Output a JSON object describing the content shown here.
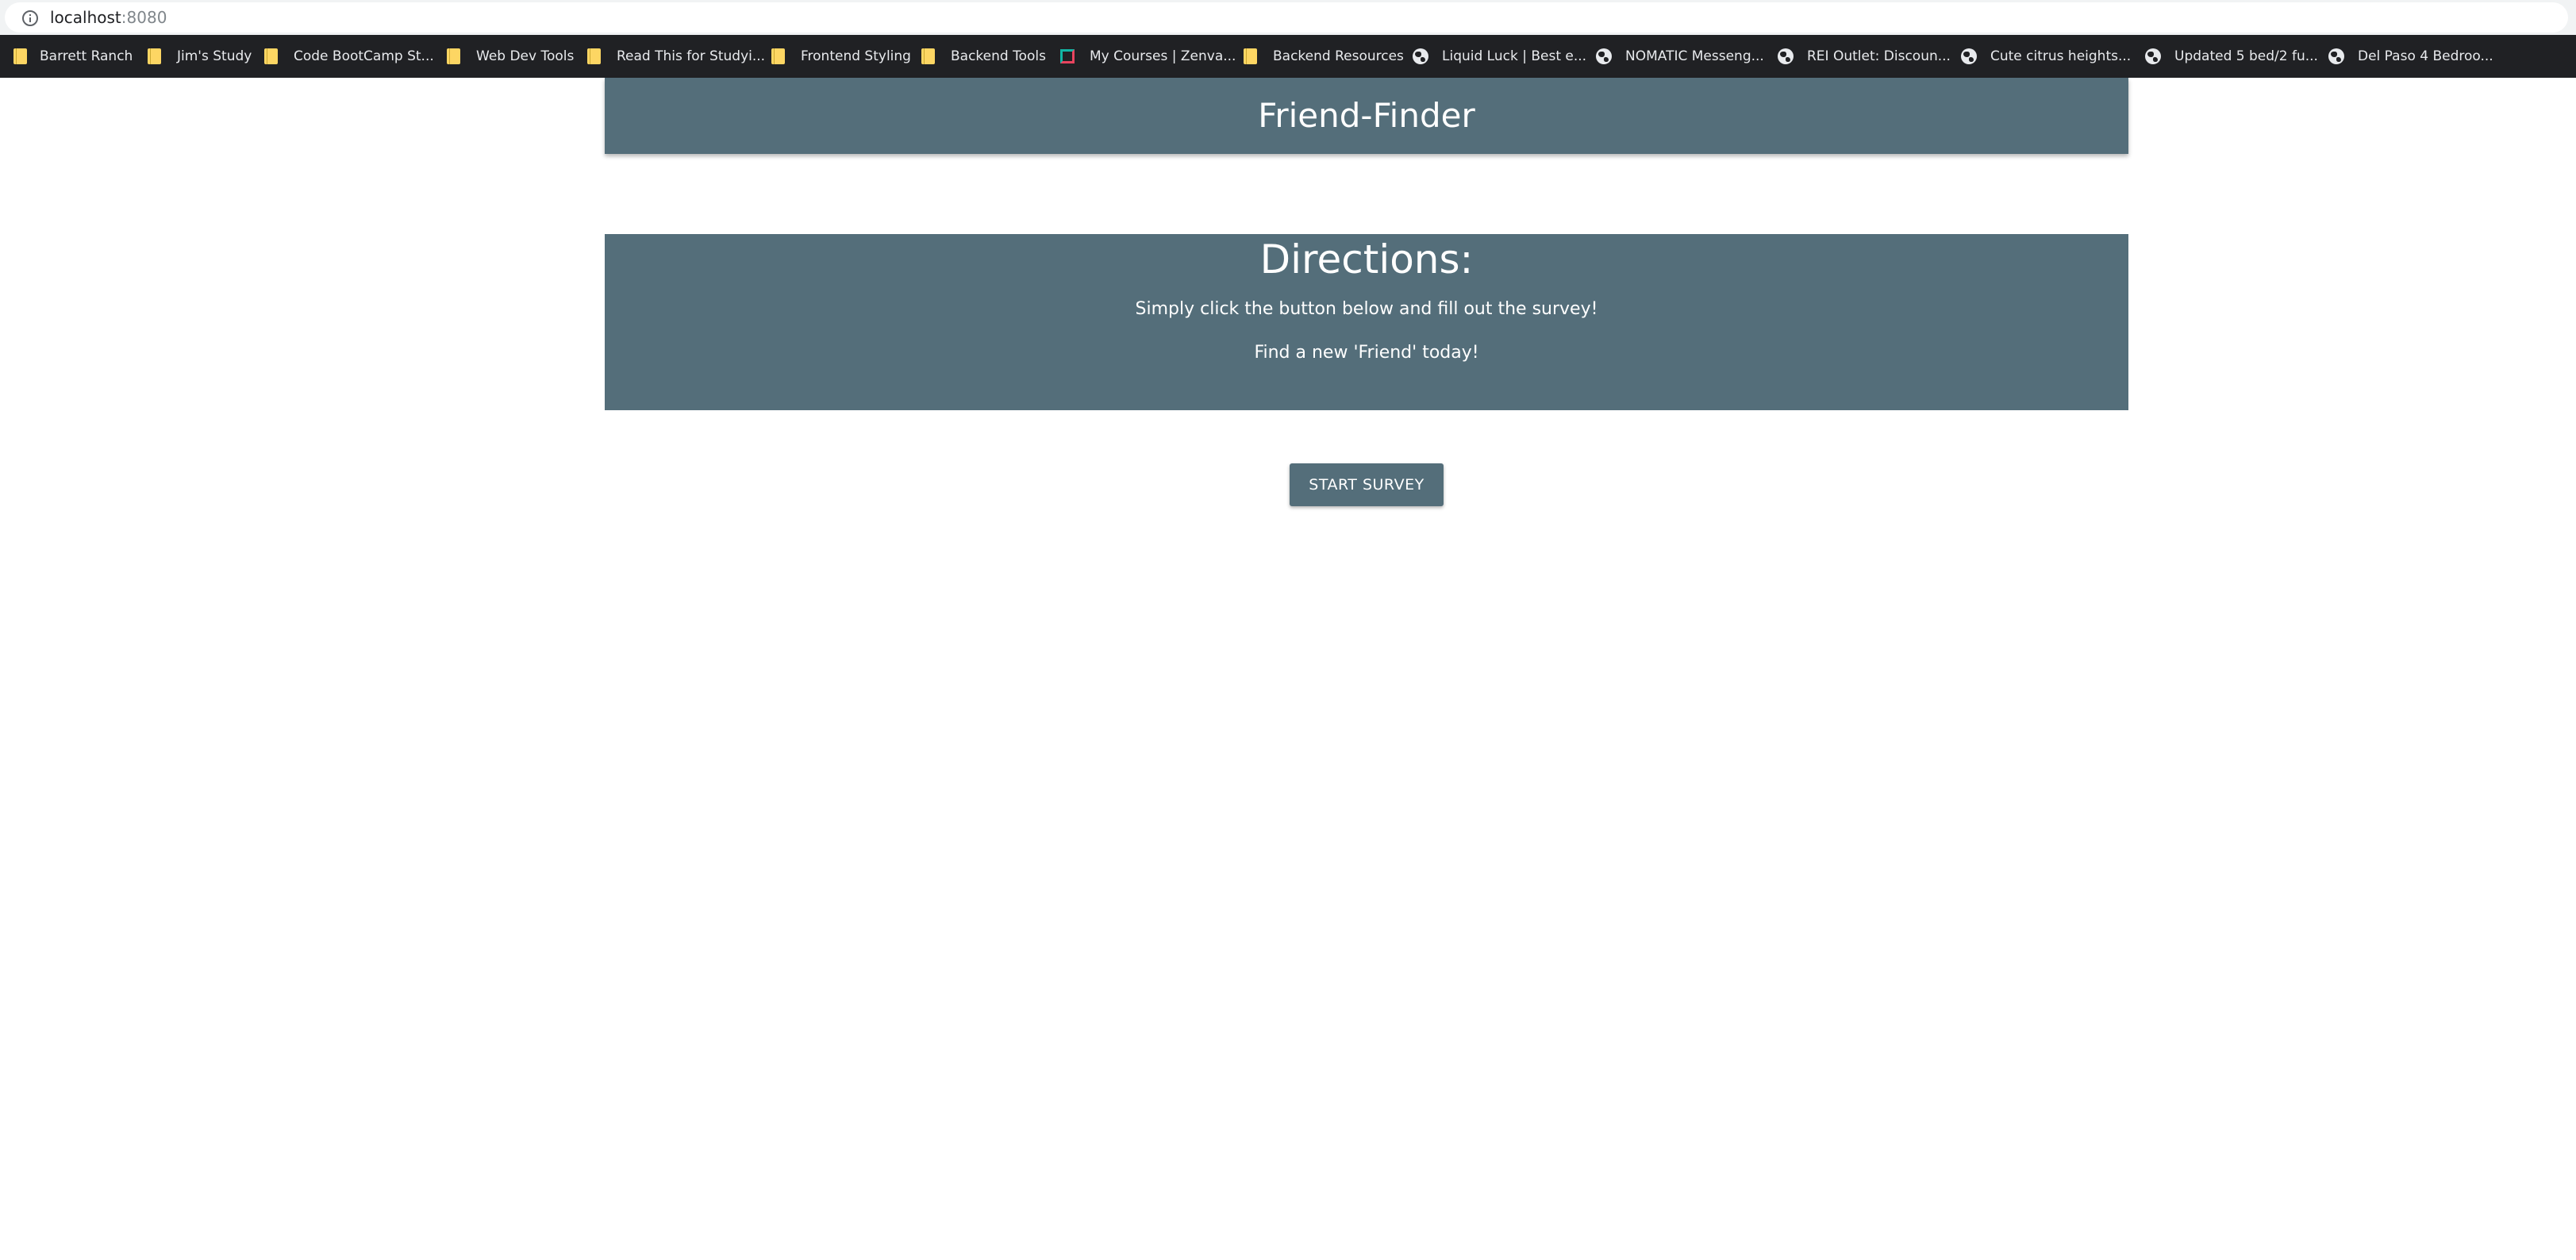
{
  "browser": {
    "url_host": "localhost",
    "url_port": ":8080",
    "bookmarks": [
      {
        "label": "Barrett Ranch",
        "icon": "folder-icon"
      },
      {
        "label": "Jim's Study",
        "icon": "folder-icon"
      },
      {
        "label": "Code BootCamp St...",
        "icon": "folder-icon"
      },
      {
        "label": "Web Dev Tools",
        "icon": "folder-icon"
      },
      {
        "label": "Read This for Studyi...",
        "icon": "folder-icon"
      },
      {
        "label": "Frontend Styling",
        "icon": "folder-icon"
      },
      {
        "label": "Backend Tools",
        "icon": "folder-icon"
      },
      {
        "label": "My Courses | Zenva...",
        "icon": "zenva-icon"
      },
      {
        "label": "Backend Resources",
        "icon": "folder-icon"
      },
      {
        "label": "Liquid Luck | Best e...",
        "icon": "globe-icon"
      },
      {
        "label": "NOMATIC Messeng...",
        "icon": "globe-icon"
      },
      {
        "label": "REI Outlet: Discoun...",
        "icon": "globe-icon"
      },
      {
        "label": "Cute citrus heights...",
        "icon": "globe-icon"
      },
      {
        "label": "Updated 5 bed/2 fu...",
        "icon": "globe-icon"
      },
      {
        "label": "Del Paso 4 Bedroo...",
        "icon": "globe-icon"
      }
    ]
  },
  "header": {
    "title": "Friend-Finder"
  },
  "directions": {
    "title": "Directions:",
    "line1": "Simply click the button below and fill out the survey!",
    "line2": "Find a new 'Friend' today!"
  },
  "actions": {
    "start_label": "START SURVEY"
  },
  "colors": {
    "accent": "#546e7a",
    "bookmark_bar": "#202124",
    "address_bar": "#f1f3f4"
  }
}
